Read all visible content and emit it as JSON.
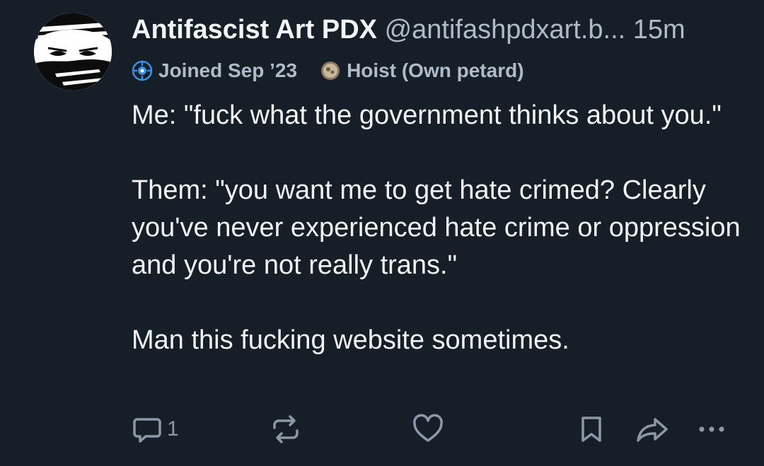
{
  "post": {
    "author": {
      "display_name": "Antifascist Art PDX",
      "handle": "@antifashpdxart.b...",
      "avatar_icon": "masked-face-avatar"
    },
    "timestamp": "15m",
    "badges": [
      {
        "icon": "globe-badge-icon",
        "label": "Joined Sep ’23"
      },
      {
        "icon": "petard-badge-icon",
        "label": "Hoist (Own petard)"
      }
    ],
    "text": {
      "p1": "Me: \"fuck what the government thinks about you.\"",
      "p2": "Them: \"you want me to get hate crimed? Clearly you've never experienced hate crime or oppression and you're not really trans.\"",
      "p3": "Man this fucking website sometimes."
    },
    "actions": {
      "reply_count": "1"
    }
  },
  "colors": {
    "background": "#161e27",
    "text": "#f1f3f5",
    "muted": "#aebbc9",
    "icon": "#8a98a8",
    "badge_blue": "#3d8ee0"
  }
}
